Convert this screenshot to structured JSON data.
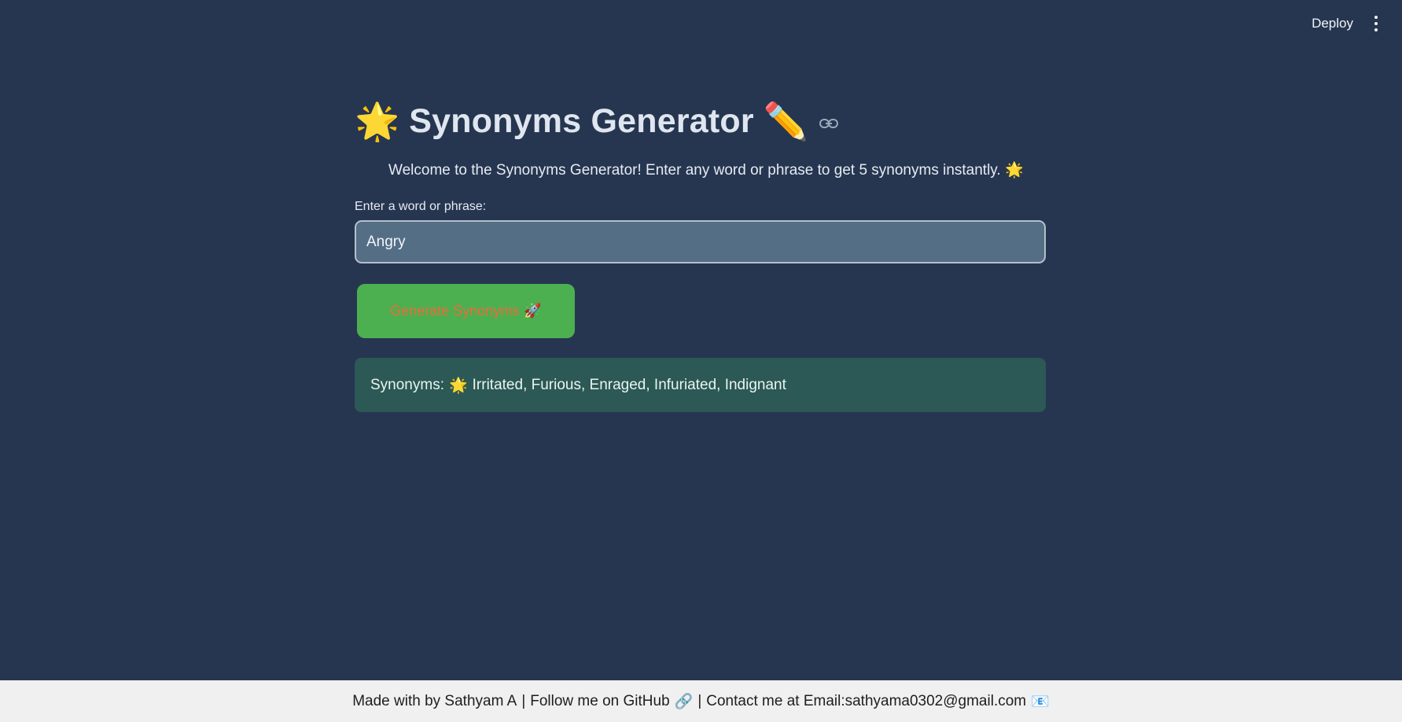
{
  "topbar": {
    "deploy_label": "Deploy",
    "menu_icon": "kebab-menu-icon"
  },
  "header": {
    "star_emoji": "🌟",
    "title": "Synonyms Generator",
    "pencil_emoji": "✏️",
    "link_icon": "link-icon"
  },
  "intro": {
    "text": "Welcome to the Synonyms Generator! Enter any word or phrase to get 5 synonyms instantly.",
    "emoji": "🌟"
  },
  "input": {
    "label": "Enter a word or phrase:",
    "value": "Angry"
  },
  "button": {
    "label": "Generate Synonyms",
    "emoji": "🚀"
  },
  "result": {
    "prefix": "Synonyms:",
    "emoji": "🌟",
    "text": "Irritated, Furious, Enraged, Infuriated, Indignant"
  },
  "footer": {
    "made_by": "Made with by Sathyam A",
    "github": "Follow me on GitHub",
    "github_emoji": "🔗",
    "contact": "Contact me at Email:sathyama0302@gmail.com",
    "email_emoji": "📧",
    "separator": "|"
  },
  "colors": {
    "background": "#263650",
    "button_bg": "#4cb050",
    "button_text": "#ec6b3c",
    "result_bg": "#2c5856",
    "input_bg": "#546e86",
    "footer_bg": "#f0f0f0"
  }
}
